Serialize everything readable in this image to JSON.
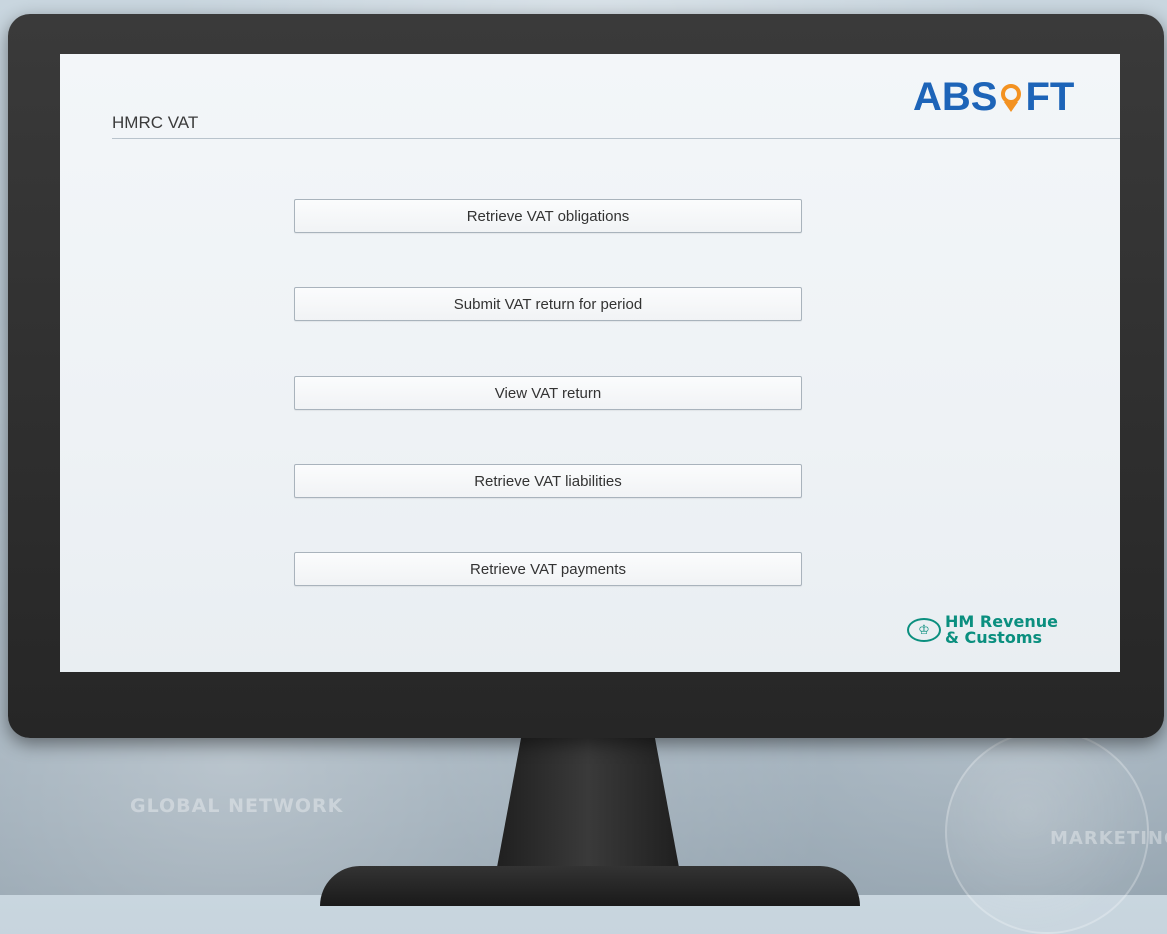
{
  "app": {
    "title": "HMRC VAT"
  },
  "branding": {
    "absoft_left": "ABS",
    "absoft_right": "FT",
    "hmrc_line1": "HM Revenue",
    "hmrc_line2": "& Customs",
    "absoft_color": "#1d64b8",
    "absoft_accent": "#f39221",
    "hmrc_color": "#0b8f7f",
    "hmrc_icon": "crown-crest-icon"
  },
  "actions": [
    {
      "label": "Retrieve VAT obligations"
    },
    {
      "label": "Submit VAT return for period"
    },
    {
      "label": "View VAT return"
    },
    {
      "label": "Retrieve VAT liabilities"
    },
    {
      "label": "Retrieve VAT payments"
    }
  ],
  "background": {
    "text1": "GLOBAL NETWORK",
    "text2": "MARKETING"
  }
}
